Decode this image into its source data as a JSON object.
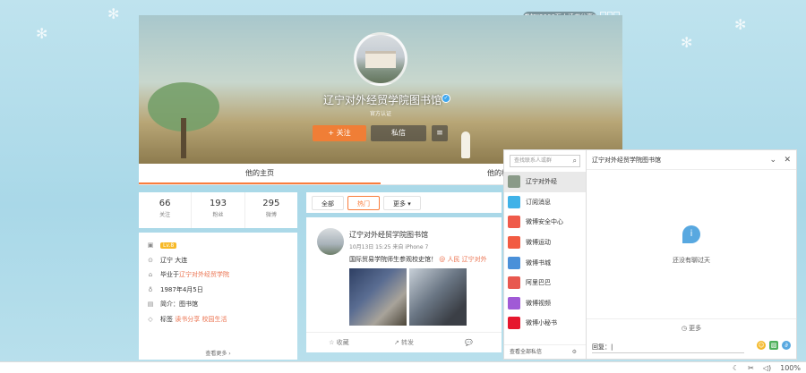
{
  "top_banner": "参加\"2000万人读书分享\"",
  "profile": {
    "name": "辽宁对外经贸学院图书馆",
    "subtitle": "官方认证",
    "follow_button": "+ 关注",
    "message_button": "私信"
  },
  "tabs": [
    {
      "label": "他的主页"
    },
    {
      "label": "他的相册"
    }
  ],
  "stats": [
    {
      "value": "66",
      "label": "关注"
    },
    {
      "value": "193",
      "label": "粉丝"
    },
    {
      "value": "295",
      "label": "微博"
    }
  ],
  "about": {
    "level": "Lv.8",
    "location": "辽宁 大连",
    "school_prefix": "毕业于",
    "school": "辽宁对外经贸学院",
    "birthday": "1987年4月5日",
    "intro": "简介：图书馆",
    "tags_prefix": "标签",
    "tags": "读书分享 校园生活",
    "more": "查看更多 ›"
  },
  "feed": {
    "tabs": [
      {
        "label": "全部"
      },
      {
        "label": "热门"
      },
      {
        "label": "更多 ▾"
      }
    ],
    "post": {
      "author": "辽宁对外经贸学院图书馆",
      "meta": "10月13日 15:25 来自 iPhone 7",
      "text_lead": "国际贸易学院师生参观校史馆！",
      "text_link": "@ 人民 辽宁对外",
      "actions": [
        "☆ 收藏",
        "↗ 转发",
        "💬"
      ]
    }
  },
  "chat": {
    "search_placeholder": "查找联系人或群",
    "contacts": [
      {
        "label": "辽宁对外经",
        "icon": "library-avatar-icon",
        "color": "#8a9a88"
      },
      {
        "label": "订阅消息",
        "icon": "rss-icon",
        "color": "#3fb2e8"
      },
      {
        "label": "微博安全中心",
        "icon": "shield-icon",
        "color": "#ef5a4a"
      },
      {
        "label": "微博运动",
        "icon": "runner-icon",
        "color": "#f25b42"
      },
      {
        "label": "微博书城",
        "icon": "book-icon",
        "color": "#4a90d9"
      },
      {
        "label": "阿里巴巴",
        "icon": "gift-icon",
        "color": "#e8584f"
      },
      {
        "label": "微博视频",
        "icon": "play-icon",
        "color": "#a05ad6"
      },
      {
        "label": "微博小秘书",
        "icon": "weibo-icon",
        "color": "#e6162d"
      }
    ],
    "footer": "查看全部私信",
    "title": "辽宁对外经贸学院图书馆",
    "tip": "还没有聊过天",
    "more": "更多",
    "input_value": "回复：|"
  },
  "taskbar": {
    "zoom": "100%"
  }
}
